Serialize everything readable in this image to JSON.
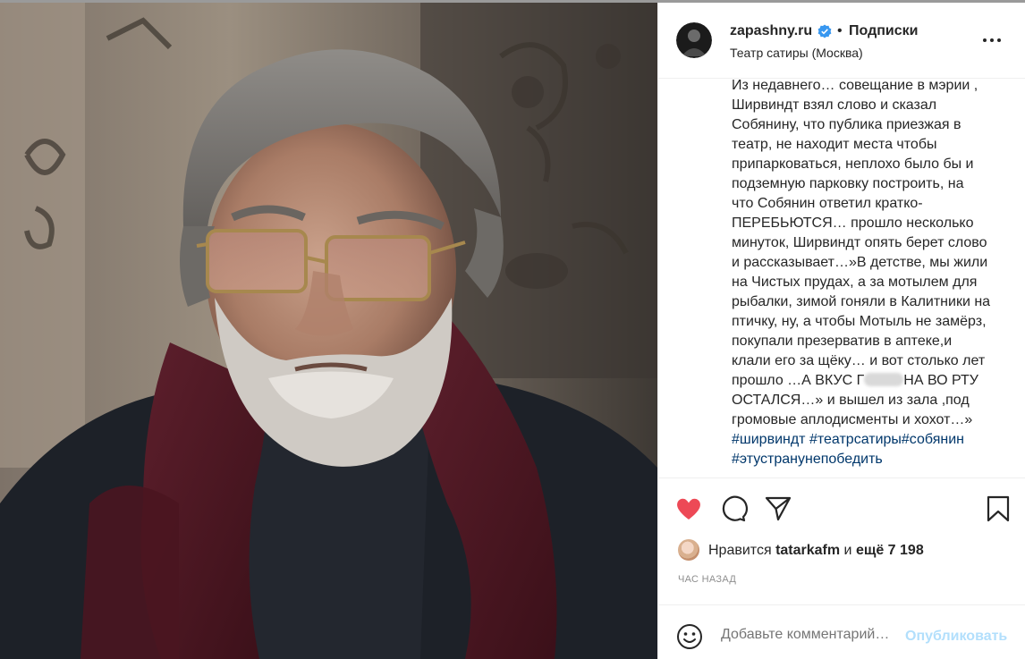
{
  "post": {
    "username": "zapashny.ru",
    "separator": "•",
    "follow_label": "Подписки",
    "location": "Театр сатиры (Москва)",
    "verified": true
  },
  "caption": {
    "lines": [
      "Из недавнего… совещание в мэрии ,",
      "Ширвиндт взял слово и сказал",
      "Собянину, что публика приезжая в",
      "театр, не находит места чтобы",
      "припарковаться, неплохо было бы и",
      "подземную парковку построить, на",
      "что Собянин ответил кратко-",
      "ПЕРЕБЬЮТСЯ… прошло несколько",
      "минуток, Ширвиндт опять берет слово",
      "и рассказывает…»В детстве, мы жили",
      "на Чистых прудах, а за мотылем для",
      "рыбалки, зимой гоняли в Калитники на",
      "птичку, ну, а чтобы Мотыль не замёрз,",
      "покупали презерватив в аптеке,и",
      "клали его за щёку… и вот столько лет"
    ],
    "line16_before": "прошло …А ВКУС Г",
    "line16_after": "НА ВО РТУ",
    "line17": "ОСТАЛСЯ…» и вышел из зала ,под",
    "line18": "громовые аплодисменты и хохот…»",
    "hashtags": [
      "#ширвиндт",
      "#театрсатиры",
      "#собянин",
      "#этустранунепобедить"
    ]
  },
  "actions": {
    "like_icon": "heart-filled-icon",
    "comment_icon": "comment-icon",
    "share_icon": "paper-plane-icon",
    "save_icon": "bookmark-icon",
    "like_color": "#ed4956"
  },
  "likes": {
    "prefix": "Нравится",
    "user": "tatarkafm",
    "middle": "и",
    "count": "ещё 7 198"
  },
  "timestamp": "ЧАС НАЗАД",
  "comment": {
    "placeholder": "Добавьте комментарий…",
    "publish_label": "Опубликовать",
    "publish_color": "#b2dffc"
  }
}
